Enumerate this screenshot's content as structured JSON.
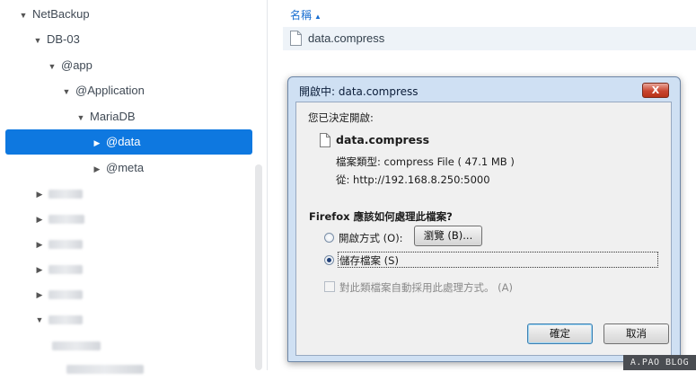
{
  "tree": {
    "items": [
      {
        "label": "NetBackup"
      },
      {
        "label": "DB-03"
      },
      {
        "label": "@app"
      },
      {
        "label": "@Application"
      },
      {
        "label": "MariaDB"
      },
      {
        "label": "@data"
      },
      {
        "label": "@meta"
      }
    ]
  },
  "files": {
    "column_name": "名稱",
    "rows": [
      {
        "name": "data.compress"
      }
    ]
  },
  "dialog": {
    "title": "開啟中: data.compress",
    "close_label": "X",
    "prompt": "您已決定開啟:",
    "filename": "data.compress",
    "filetype": "檔案類型: compress File ( 47.1 MB )",
    "from": "從: http://192.168.8.250:5000",
    "question": "Firefox 應該如何處理此檔案?",
    "open_with_label": "開啟方式",
    "open_with_key": "(O):",
    "browse_label": "瀏覽 (B)...",
    "save_label": "儲存檔案",
    "save_key": "(S)",
    "auto_label": "對此類檔案自動採用此處理方式。",
    "auto_key": "(A)",
    "ok_label": "確定",
    "cancel_label": "取消"
  },
  "watermark": "A.PAO BLOG",
  "colors": {
    "selection": "#0e78e0",
    "link": "#1a6fd1",
    "dialog_frame": "#cfe0f3"
  }
}
